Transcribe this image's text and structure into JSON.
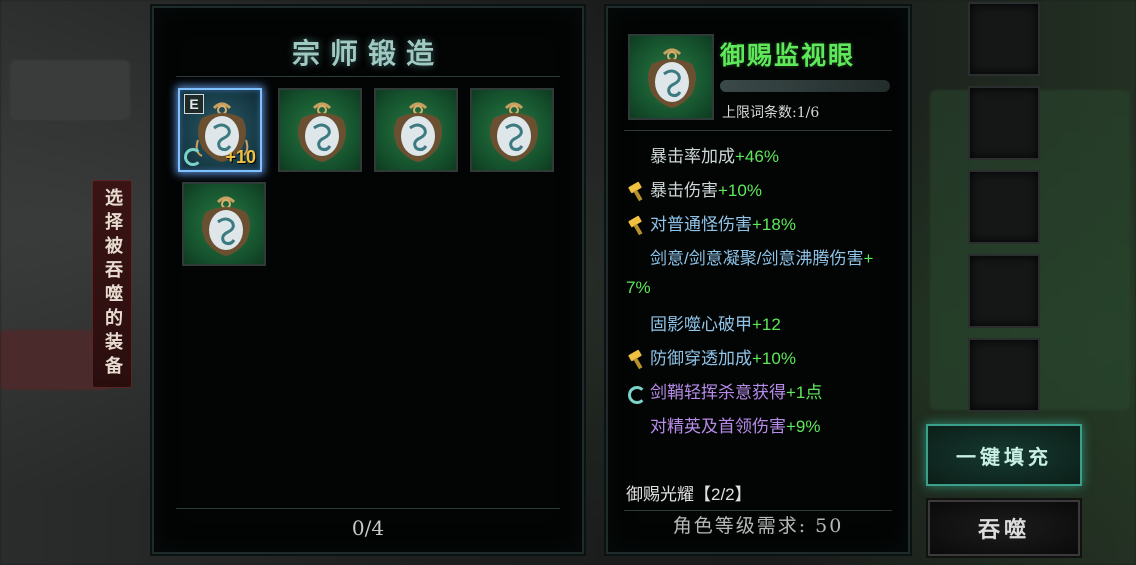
{
  "forge_panel": {
    "title": "宗师锻造",
    "count": "0/4",
    "selected_slot": {
      "badge": "E",
      "level": "10"
    }
  },
  "side_tab": {
    "label": "选择被吞噬的装备"
  },
  "item_detail": {
    "name": "御赐监视眼",
    "limit_label": "上限词条数:1/6",
    "stats": [
      {
        "icon": "none",
        "name": "暴击率加成",
        "value": "+46%"
      },
      {
        "icon": "hammer-icon",
        "name": "暴击伤害",
        "value": "+10%"
      },
      {
        "icon": "hammer-icon",
        "name": "对普通怪伤害",
        "value": "+18%"
      },
      {
        "icon": "none",
        "name": "剑意/剑意凝聚/剑意沸腾伤害",
        "value": "+"
      },
      {
        "icon": "none",
        "name": "",
        "value": "7%"
      },
      {
        "icon": "none",
        "name": "固影噬心破甲",
        "value": "+12"
      },
      {
        "icon": "hammer-icon",
        "name": "防御穿透加成",
        "value": "+10%"
      },
      {
        "icon": "refresh-icon",
        "name": "剑鞘轻挥杀意获得",
        "value": "+1点"
      },
      {
        "icon": "none",
        "name": "对精英及首领伤害",
        "value": "+9%"
      }
    ],
    "set_bonus": "御赐光耀【2/2】",
    "requirement": "角色等级需求: 50"
  },
  "buttons": {
    "fill": "一键填充",
    "devour": "吞噬"
  },
  "colors": {
    "item_name": "#5ee85a",
    "stat_value": "#5ee85a",
    "title_glow": "#9fc9c2",
    "selected_border": "#7fc0ff",
    "fill_button_border": "#3aa08a"
  }
}
